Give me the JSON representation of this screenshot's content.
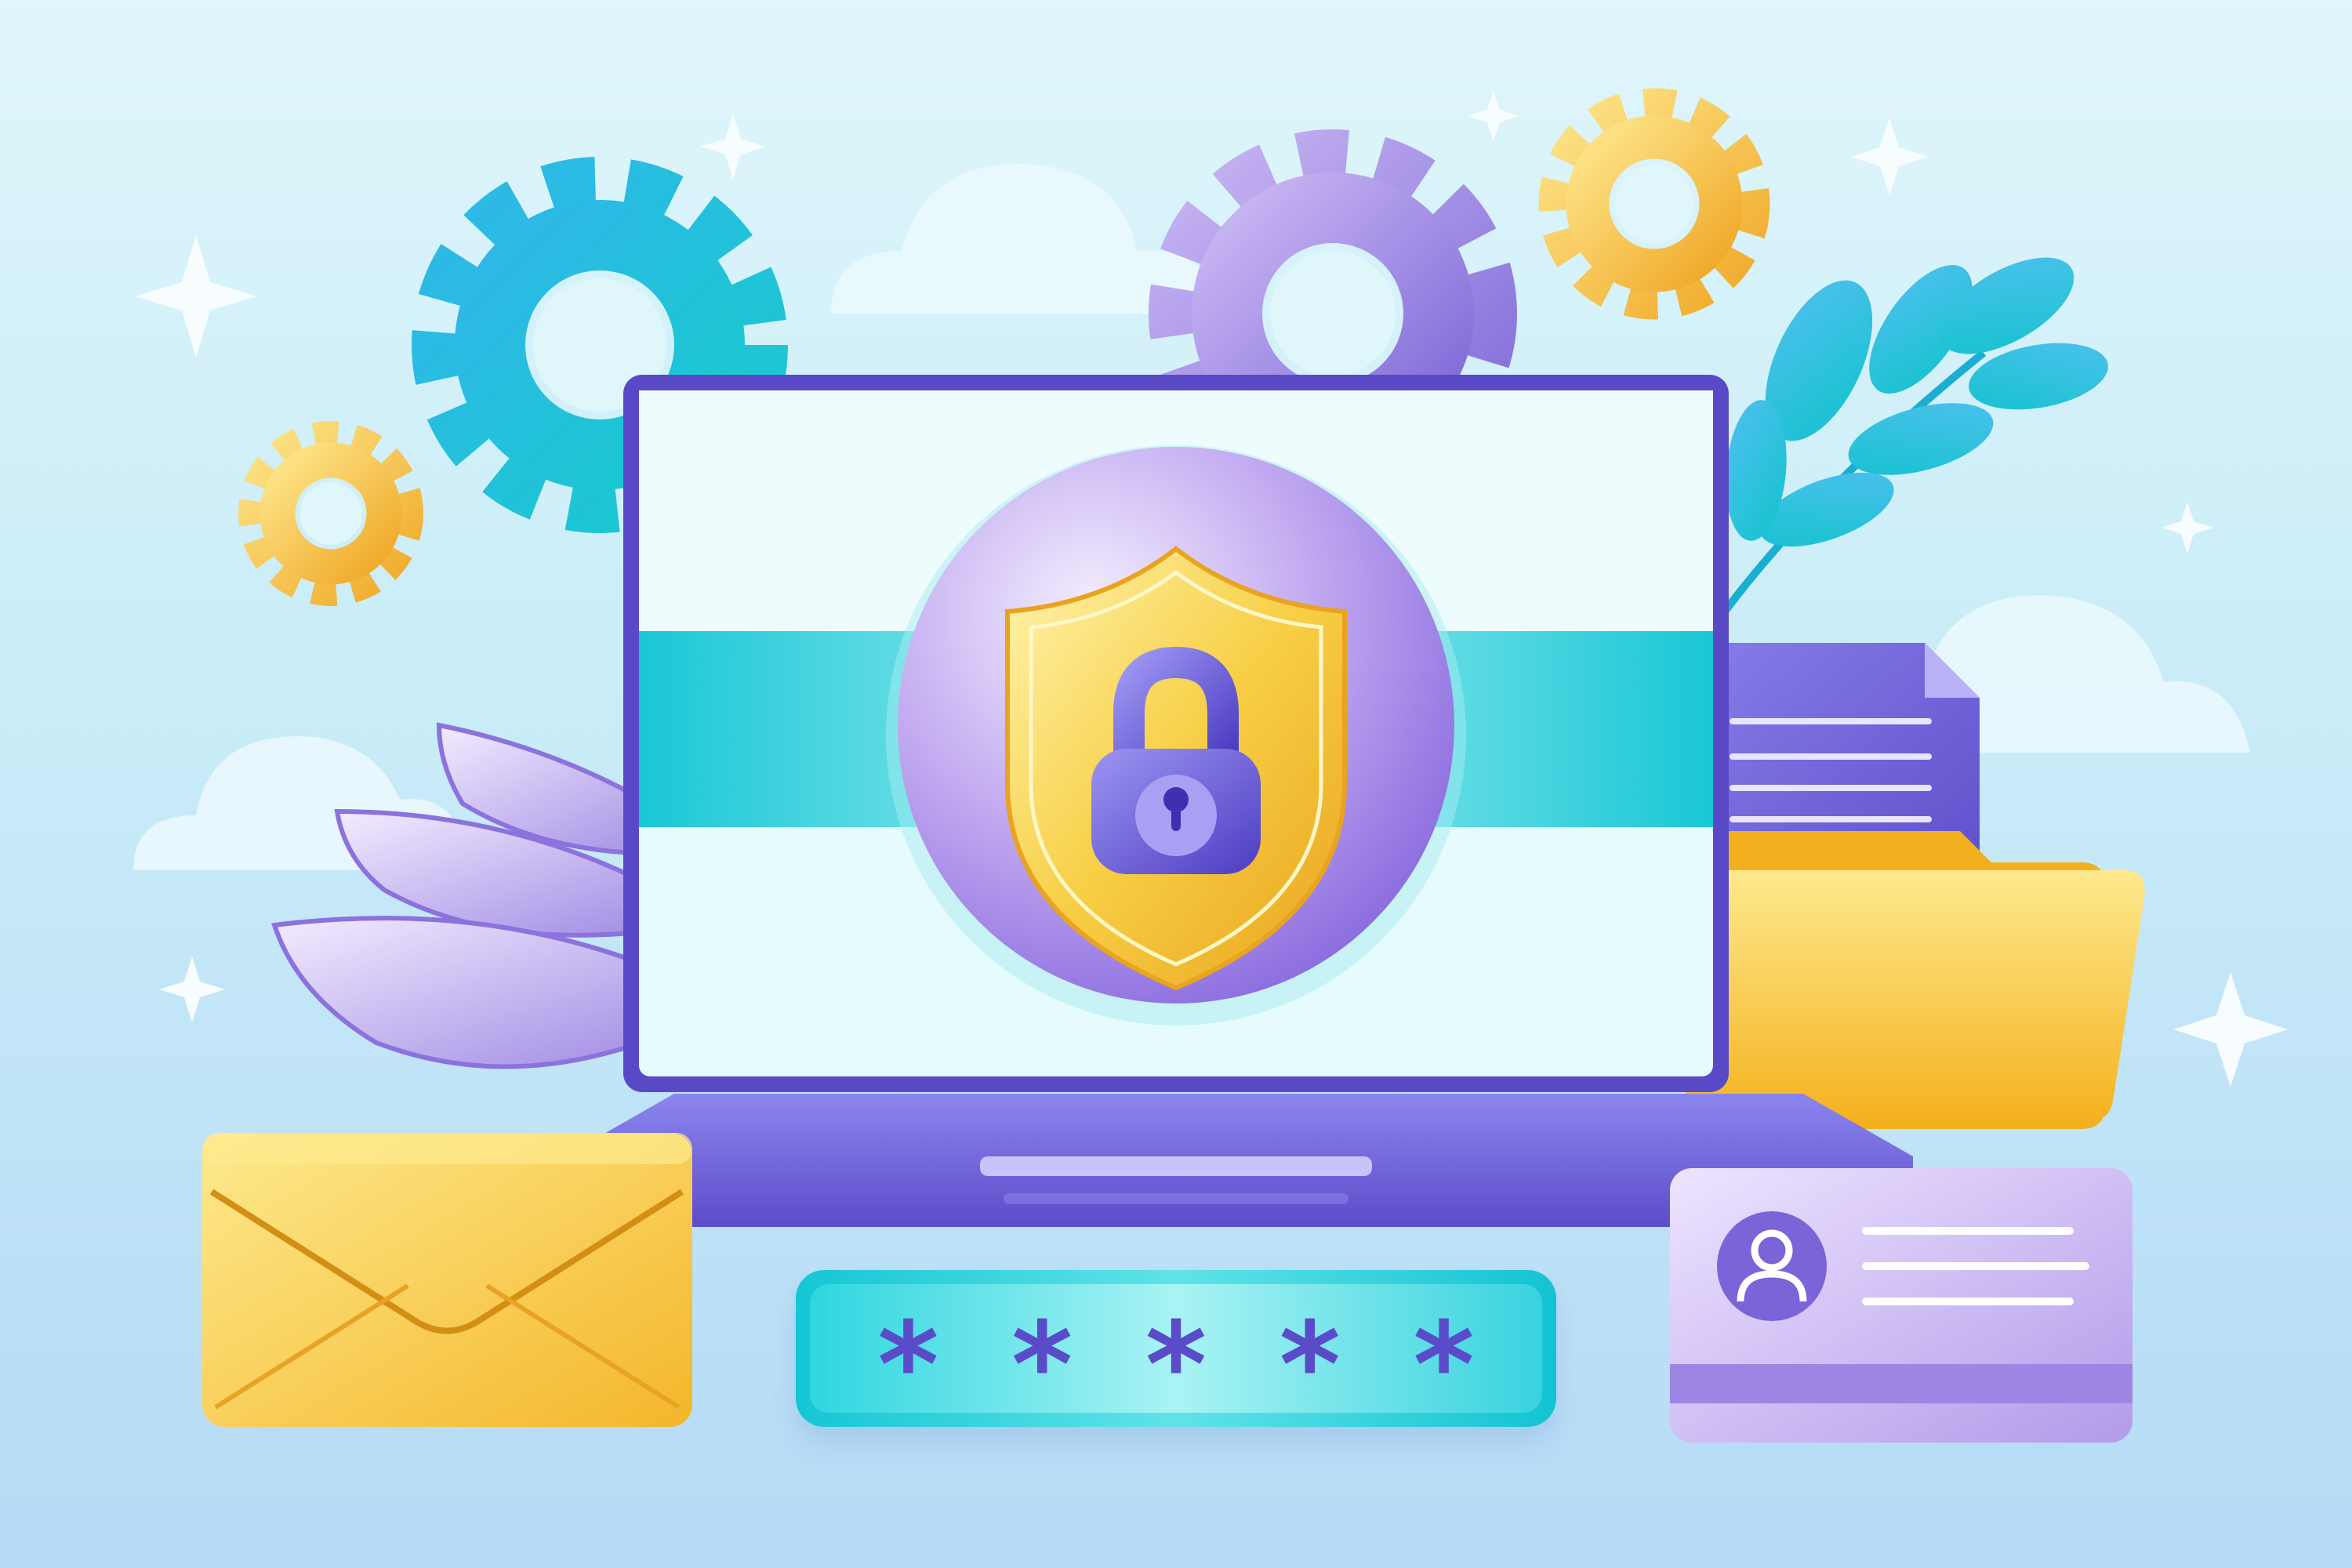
{
  "illustration": {
    "subject": "cyber-security",
    "colors": {
      "background_top": "#dff6fb",
      "background_bottom": "#b6daf6",
      "purple": "#7b6be0",
      "teal": "#19c7d6",
      "yellow": "#f7c948"
    }
  },
  "password": {
    "masked_value": "*****"
  },
  "icons": [
    "gear-icon",
    "lock-icon",
    "shield-icon",
    "envelope-icon",
    "folder-icon",
    "document-icon",
    "user-avatar-icon",
    "sparkle-icon",
    "cloud-icon",
    "leaf-icon"
  ]
}
